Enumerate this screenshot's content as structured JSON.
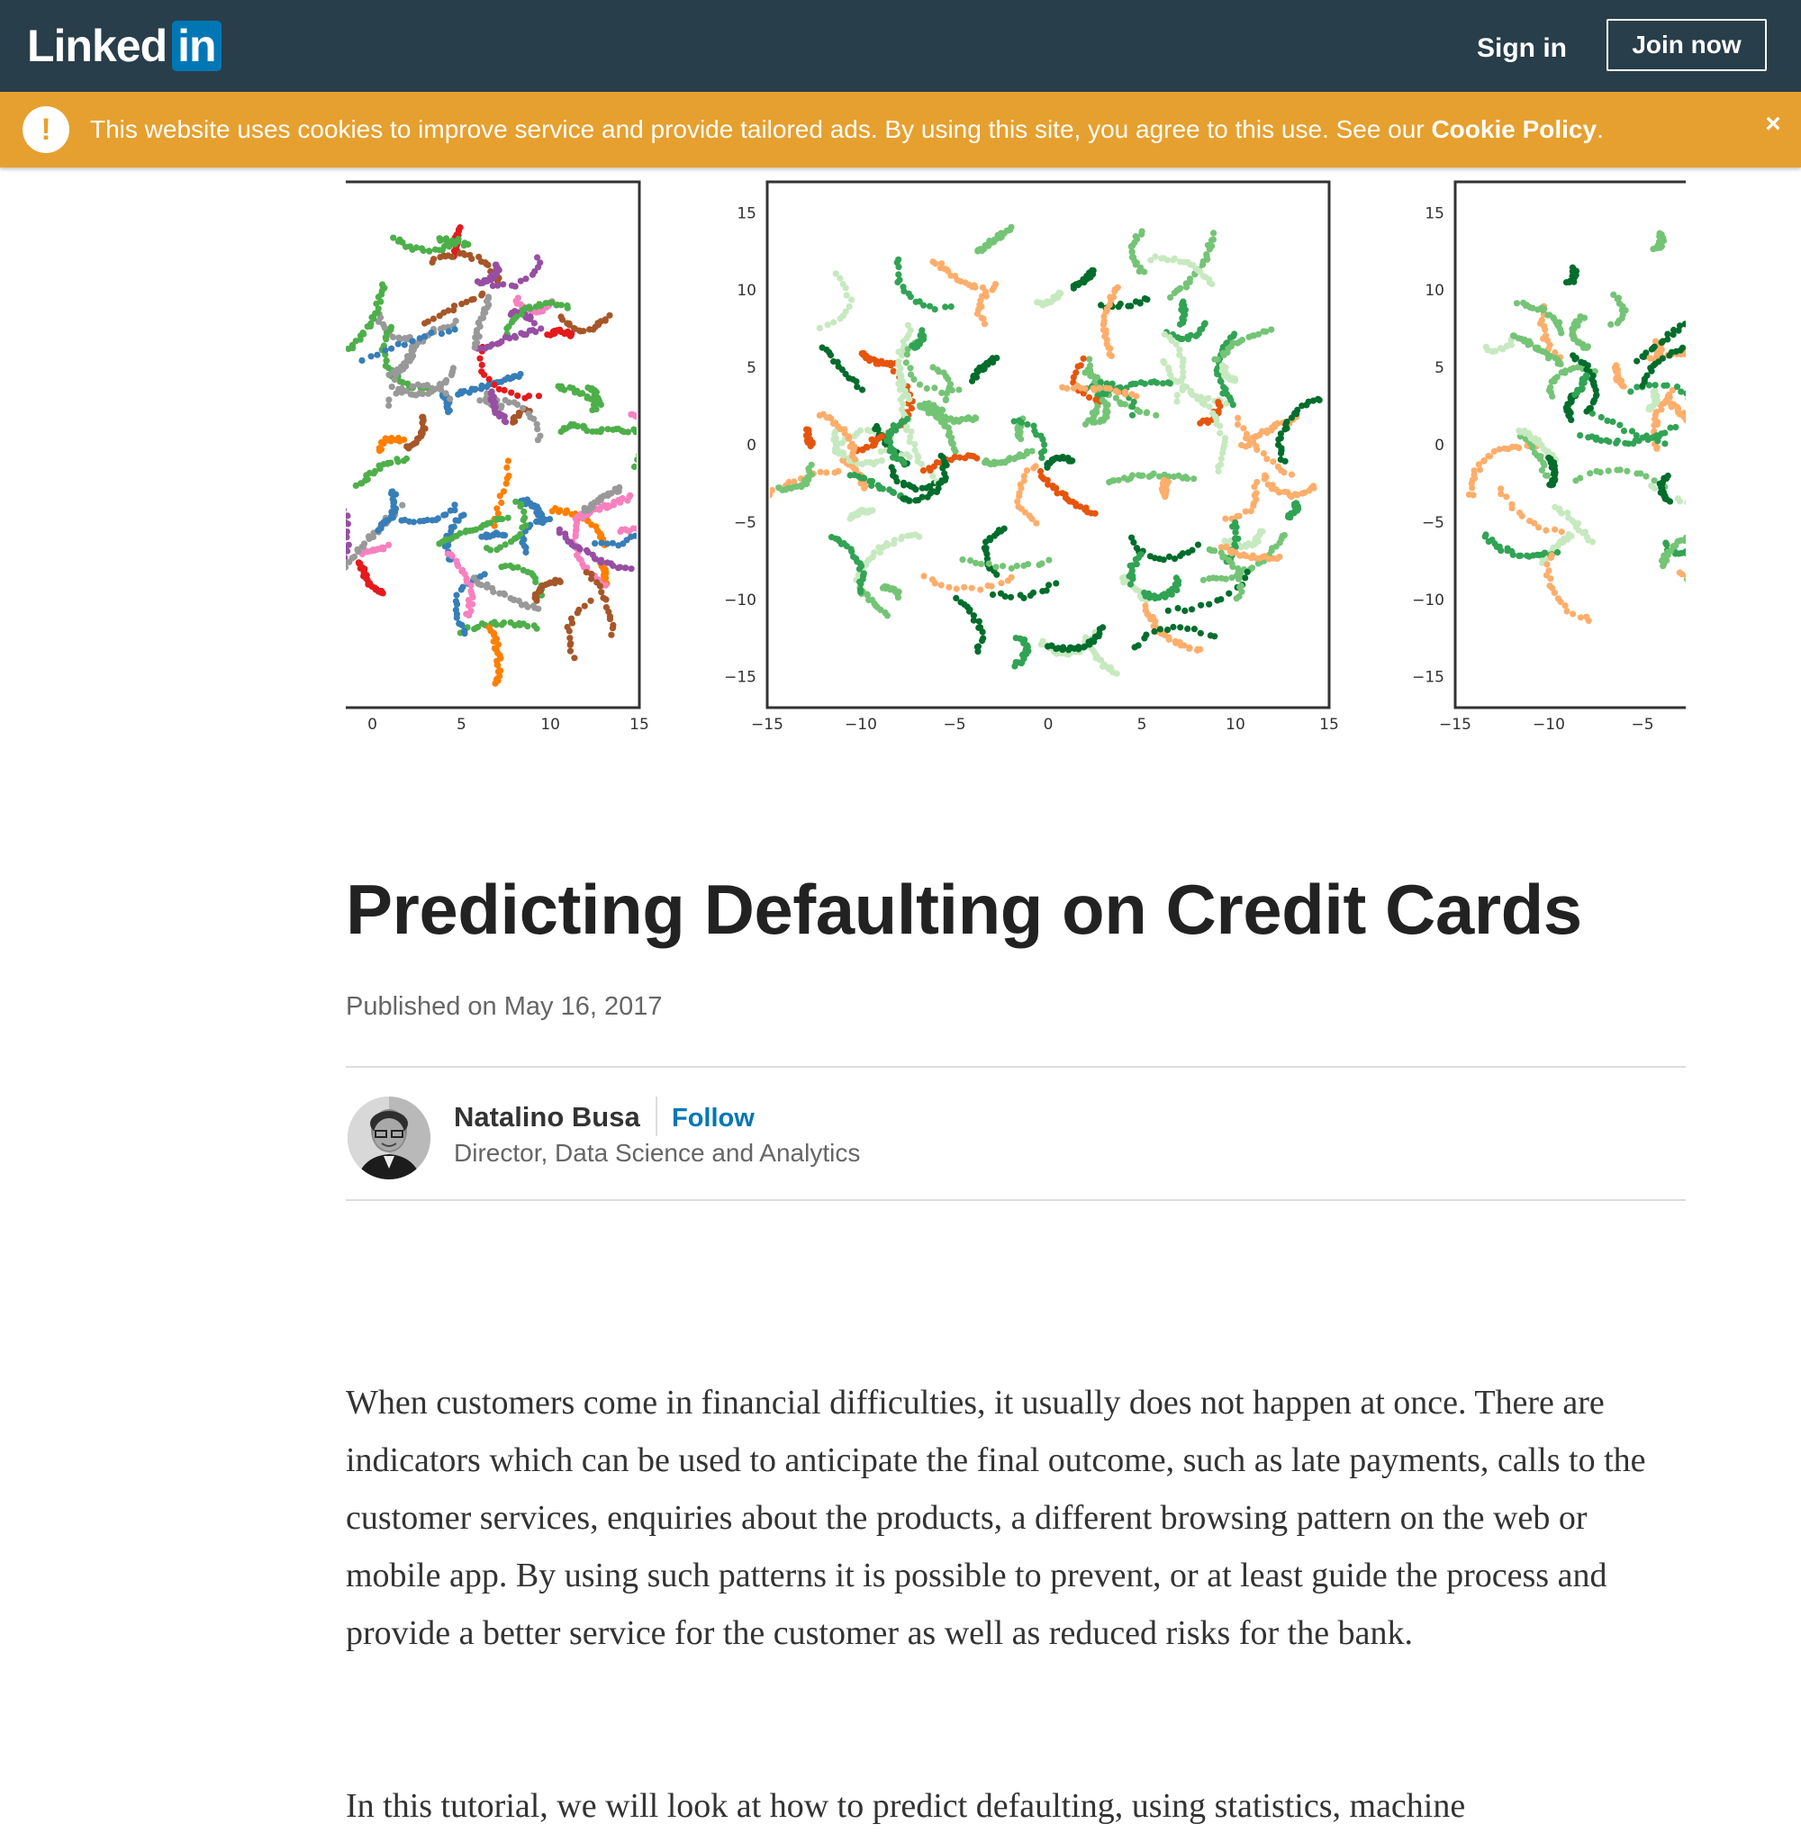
{
  "header": {
    "logo_text": "Linked",
    "logo_box": "in",
    "sign_in": "Sign in",
    "join_now": "Join now",
    "bg_color": "#283e4a",
    "brand_color": "#0077b5"
  },
  "cookie_banner": {
    "icon": "warning-icon",
    "icon_glyph": "!",
    "text": "This website uses cookies to improve service and provide tailored ads. By using this site, you agree to this use. See our ",
    "link": "Cookie Policy",
    "suffix": ".",
    "close": "×",
    "bg_color": "#e6a02f"
  },
  "chart_data": [
    {
      "type": "scatter",
      "title": "",
      "x_ticks": [
        "0",
        "5",
        "10",
        "15"
      ],
      "y_ticks": [],
      "xlim": [
        -2,
        15
      ],
      "ylim": [
        -17,
        17
      ],
      "note_colors": [
        "#e41a1c",
        "#377eb8",
        "#4daf4a",
        "#984ea3",
        "#ff7f00",
        "#f781bf",
        "#999999",
        "#a65628"
      ]
    },
    {
      "type": "scatter",
      "title": "",
      "x_ticks": [
        "−15",
        "−10",
        "−5",
        "0",
        "5",
        "10",
        "15"
      ],
      "y_ticks": [
        "15",
        "10",
        "5",
        "0",
        "−5",
        "−10",
        "−15"
      ],
      "xlim": [
        -15,
        15
      ],
      "ylim": [
        -17,
        17
      ],
      "note_colors": [
        "#006d2c",
        "#31a354",
        "#74c476",
        "#c7e9c0",
        "#fdae6b",
        "#e6550d"
      ]
    },
    {
      "type": "scatter",
      "title": "",
      "x_ticks": [
        "−15",
        "−10",
        "−5"
      ],
      "y_ticks": [
        "15",
        "10",
        "5",
        "0",
        "−5",
        "−10",
        "−15"
      ],
      "xlim": [
        -15,
        15
      ],
      "ylim": [
        -17,
        17
      ],
      "note_colors": [
        "#006d2c",
        "#31a354",
        "#74c476",
        "#c7e9c0",
        "#fdae6b"
      ]
    }
  ],
  "article": {
    "title": "Predicting Defaulting on Credit Cards",
    "published": "Published on May 16, 2017",
    "author": {
      "name": "Natalino Busa",
      "follow": "Follow",
      "title": "Director, Data Science and Analytics"
    },
    "paragraphs": [
      "When customers come in financial difficulties, it usually does not happen at once. There are indicators which can be used to anticipate the final outcome, such as late payments, calls to the customer services, enquiries about the products, a different browsing pattern on the web or mobile app. By using such patterns it is possible to prevent, or at least guide the process and provide a better service for the customer as well as reduced risks for the bank.",
      "In this tutorial, we will look at how to predict defaulting, using statistics, machine"
    ]
  }
}
